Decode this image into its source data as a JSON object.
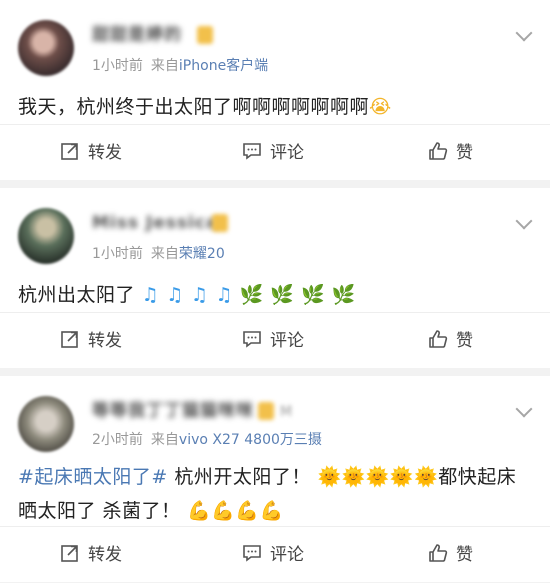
{
  "posts": [
    {
      "username": "甜甜是婷的",
      "time": "1小时前",
      "from_label": "来自",
      "device": "iPhone客户端",
      "text": "我天，杭州终于出太阳了啊啊啊啊啊啊啊",
      "emoji": "😭"
    },
    {
      "username": "Miss Jessica",
      "time": "1小时前",
      "from_label": "来自",
      "device": "荣耀20",
      "text": "杭州出太阳了",
      "notes": "♫ ♫ ♫ ♫",
      "leaves": "🌿 🌿 🌿 🌿"
    },
    {
      "username": "等等我丁丁猫猫咪咪",
      "extra": "M",
      "time": "2小时前",
      "from_label": "来自",
      "device": "vivo X27 4800万三摄",
      "hashtag": "#起床晒太阳了#",
      "text_a": " 杭州开太阳了！",
      "suns": "🌞🌞🌞🌞🌞",
      "text_b": "都快起床 晒太阳了 杀菌了！",
      "arms": "💪💪💪💪"
    }
  ],
  "actions": {
    "repost": "转发",
    "comment": "评论",
    "like": "赞"
  },
  "icons": {
    "repost": "repost-icon",
    "comment": "comment-icon",
    "like": "thumbs-up-icon",
    "menu": "chevron-down-icon"
  }
}
